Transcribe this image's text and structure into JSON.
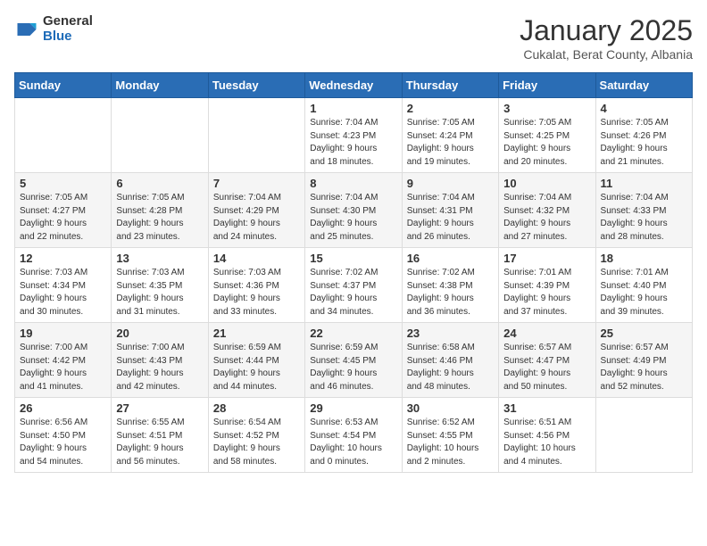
{
  "header": {
    "logo_general": "General",
    "logo_blue": "Blue",
    "month_title": "January 2025",
    "location": "Cukalat, Berat County, Albania"
  },
  "weekdays": [
    "Sunday",
    "Monday",
    "Tuesday",
    "Wednesday",
    "Thursday",
    "Friday",
    "Saturday"
  ],
  "weeks": [
    [
      {
        "day": "",
        "info": ""
      },
      {
        "day": "",
        "info": ""
      },
      {
        "day": "",
        "info": ""
      },
      {
        "day": "1",
        "info": "Sunrise: 7:04 AM\nSunset: 4:23 PM\nDaylight: 9 hours\nand 18 minutes."
      },
      {
        "day": "2",
        "info": "Sunrise: 7:05 AM\nSunset: 4:24 PM\nDaylight: 9 hours\nand 19 minutes."
      },
      {
        "day": "3",
        "info": "Sunrise: 7:05 AM\nSunset: 4:25 PM\nDaylight: 9 hours\nand 20 minutes."
      },
      {
        "day": "4",
        "info": "Sunrise: 7:05 AM\nSunset: 4:26 PM\nDaylight: 9 hours\nand 21 minutes."
      }
    ],
    [
      {
        "day": "5",
        "info": "Sunrise: 7:05 AM\nSunset: 4:27 PM\nDaylight: 9 hours\nand 22 minutes."
      },
      {
        "day": "6",
        "info": "Sunrise: 7:05 AM\nSunset: 4:28 PM\nDaylight: 9 hours\nand 23 minutes."
      },
      {
        "day": "7",
        "info": "Sunrise: 7:04 AM\nSunset: 4:29 PM\nDaylight: 9 hours\nand 24 minutes."
      },
      {
        "day": "8",
        "info": "Sunrise: 7:04 AM\nSunset: 4:30 PM\nDaylight: 9 hours\nand 25 minutes."
      },
      {
        "day": "9",
        "info": "Sunrise: 7:04 AM\nSunset: 4:31 PM\nDaylight: 9 hours\nand 26 minutes."
      },
      {
        "day": "10",
        "info": "Sunrise: 7:04 AM\nSunset: 4:32 PM\nDaylight: 9 hours\nand 27 minutes."
      },
      {
        "day": "11",
        "info": "Sunrise: 7:04 AM\nSunset: 4:33 PM\nDaylight: 9 hours\nand 28 minutes."
      }
    ],
    [
      {
        "day": "12",
        "info": "Sunrise: 7:03 AM\nSunset: 4:34 PM\nDaylight: 9 hours\nand 30 minutes."
      },
      {
        "day": "13",
        "info": "Sunrise: 7:03 AM\nSunset: 4:35 PM\nDaylight: 9 hours\nand 31 minutes."
      },
      {
        "day": "14",
        "info": "Sunrise: 7:03 AM\nSunset: 4:36 PM\nDaylight: 9 hours\nand 33 minutes."
      },
      {
        "day": "15",
        "info": "Sunrise: 7:02 AM\nSunset: 4:37 PM\nDaylight: 9 hours\nand 34 minutes."
      },
      {
        "day": "16",
        "info": "Sunrise: 7:02 AM\nSunset: 4:38 PM\nDaylight: 9 hours\nand 36 minutes."
      },
      {
        "day": "17",
        "info": "Sunrise: 7:01 AM\nSunset: 4:39 PM\nDaylight: 9 hours\nand 37 minutes."
      },
      {
        "day": "18",
        "info": "Sunrise: 7:01 AM\nSunset: 4:40 PM\nDaylight: 9 hours\nand 39 minutes."
      }
    ],
    [
      {
        "day": "19",
        "info": "Sunrise: 7:00 AM\nSunset: 4:42 PM\nDaylight: 9 hours\nand 41 minutes."
      },
      {
        "day": "20",
        "info": "Sunrise: 7:00 AM\nSunset: 4:43 PM\nDaylight: 9 hours\nand 42 minutes."
      },
      {
        "day": "21",
        "info": "Sunrise: 6:59 AM\nSunset: 4:44 PM\nDaylight: 9 hours\nand 44 minutes."
      },
      {
        "day": "22",
        "info": "Sunrise: 6:59 AM\nSunset: 4:45 PM\nDaylight: 9 hours\nand 46 minutes."
      },
      {
        "day": "23",
        "info": "Sunrise: 6:58 AM\nSunset: 4:46 PM\nDaylight: 9 hours\nand 48 minutes."
      },
      {
        "day": "24",
        "info": "Sunrise: 6:57 AM\nSunset: 4:47 PM\nDaylight: 9 hours\nand 50 minutes."
      },
      {
        "day": "25",
        "info": "Sunrise: 6:57 AM\nSunset: 4:49 PM\nDaylight: 9 hours\nand 52 minutes."
      }
    ],
    [
      {
        "day": "26",
        "info": "Sunrise: 6:56 AM\nSunset: 4:50 PM\nDaylight: 9 hours\nand 54 minutes."
      },
      {
        "day": "27",
        "info": "Sunrise: 6:55 AM\nSunset: 4:51 PM\nDaylight: 9 hours\nand 56 minutes."
      },
      {
        "day": "28",
        "info": "Sunrise: 6:54 AM\nSunset: 4:52 PM\nDaylight: 9 hours\nand 58 minutes."
      },
      {
        "day": "29",
        "info": "Sunrise: 6:53 AM\nSunset: 4:54 PM\nDaylight: 10 hours\nand 0 minutes."
      },
      {
        "day": "30",
        "info": "Sunrise: 6:52 AM\nSunset: 4:55 PM\nDaylight: 10 hours\nand 2 minutes."
      },
      {
        "day": "31",
        "info": "Sunrise: 6:51 AM\nSunset: 4:56 PM\nDaylight: 10 hours\nand 4 minutes."
      },
      {
        "day": "",
        "info": ""
      }
    ]
  ]
}
